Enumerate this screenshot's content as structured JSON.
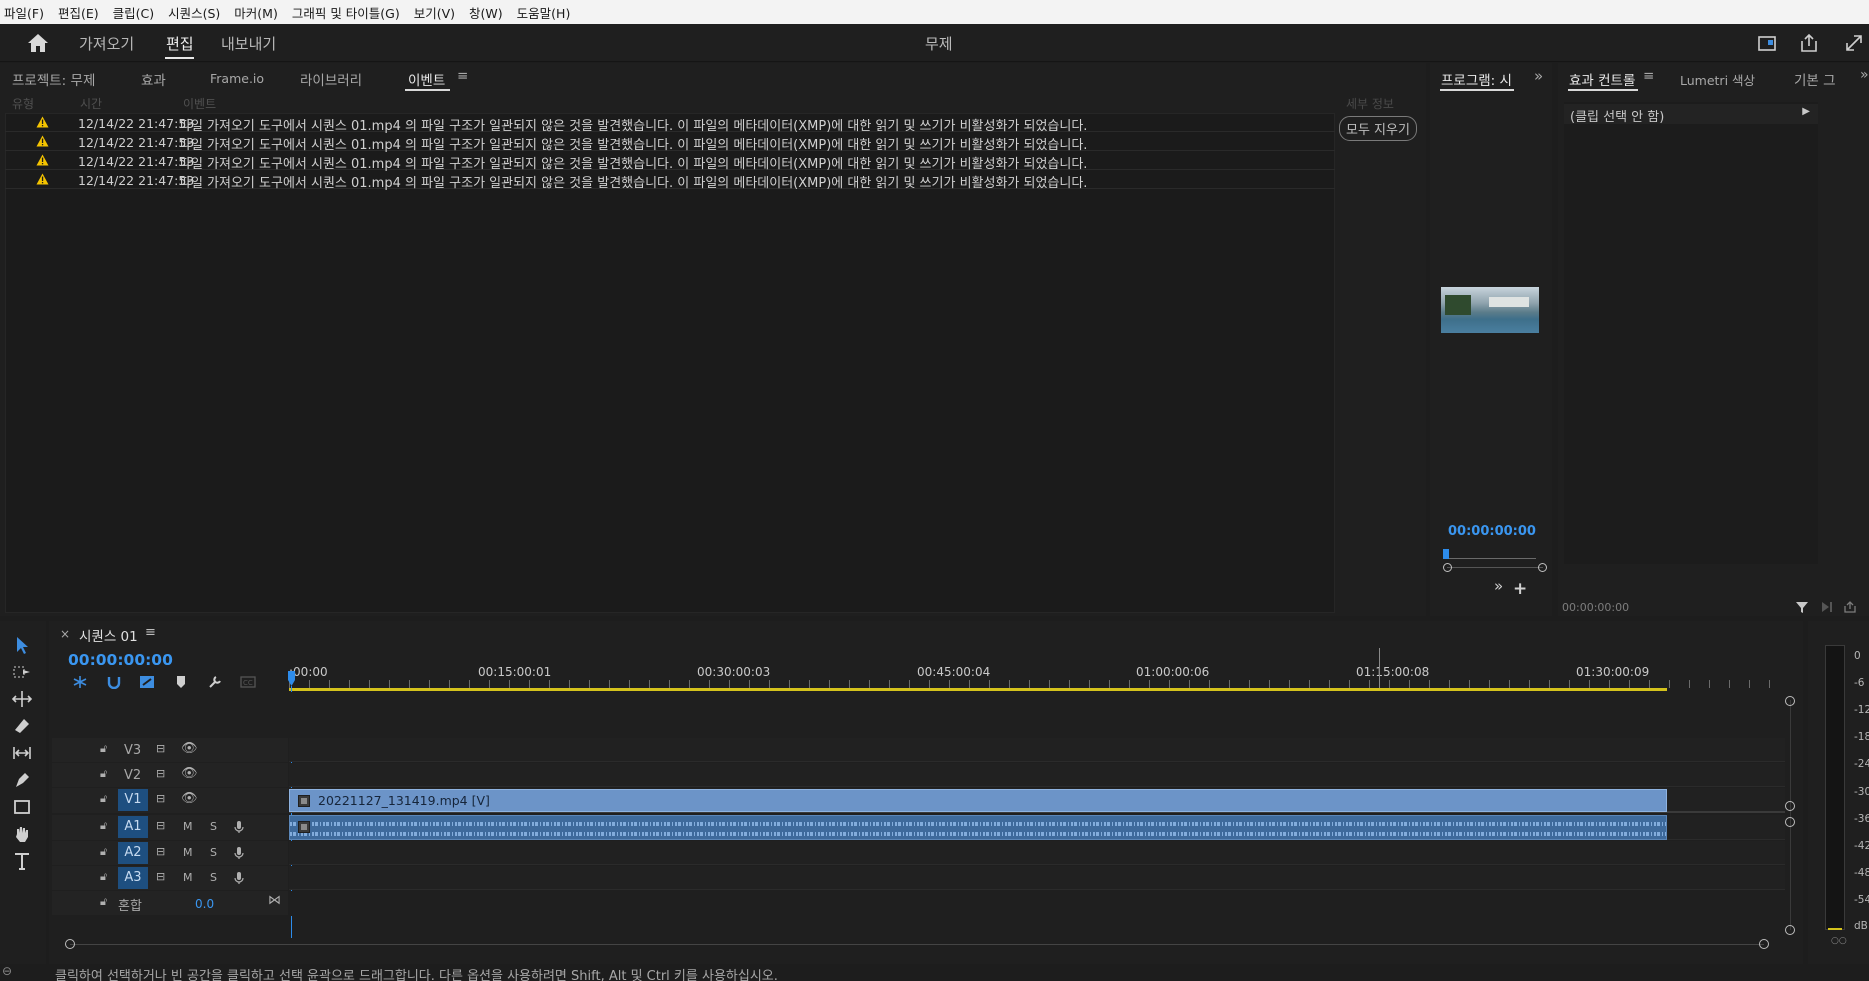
{
  "menu": [
    "파일(F)",
    "편집(E)",
    "클립(C)",
    "시퀀스(S)",
    "마커(M)",
    "그래픽 및 타이틀(G)",
    "보기(V)",
    "창(W)",
    "도움말(H)"
  ],
  "workspace": {
    "tabs": [
      "가져오기",
      "편집",
      "내보내기"
    ],
    "active_tab": "편집",
    "title": "무제"
  },
  "left_panel": {
    "tabs": [
      "프로젝트: 무제",
      "효과",
      "Frame.io",
      "라이브러리",
      "이벤트"
    ],
    "active_tab": "이벤트",
    "columns": [
      "유형",
      "시간",
      "이벤트"
    ],
    "details_label": "세부 정보",
    "clear_all_label": "모두 지우기",
    "events": [
      {
        "time": "12/14/22 21:47:53",
        "message": "파일 가져오기 도구에서 시퀀스 01.mp4 의 파일 구조가 일관되지 않은 것을 발견했습니다. 이 파일의 메타데이터(XMP)에 대한 읽기 및 쓰기가 비활성화가 되었습니다."
      },
      {
        "time": "12/14/22 21:47:53",
        "message": "파일 가져오기 도구에서 시퀀스 01.mp4 의 파일 구조가 일관되지 않은 것을 발견했습니다. 이 파일의 메타데이터(XMP)에 대한 읽기 및 쓰기가 비활성화가 되었습니다."
      },
      {
        "time": "12/14/22 21:47:53",
        "message": "파일 가져오기 도구에서 시퀀스 01.mp4 의 파일 구조가 일관되지 않은 것을 발견했습니다. 이 파일의 메타데이터(XMP)에 대한 읽기 및 쓰기가 비활성화가 되었습니다."
      },
      {
        "time": "12/14/22 21:47:53",
        "message": "파일 가져오기 도구에서 시퀀스 01.mp4 의 파일 구조가 일관되지 않은 것을 발견했습니다. 이 파일의 메타데이터(XMP)에 대한 읽기 및 쓰기가 비활성화가 되었습니다."
      }
    ]
  },
  "program_panel": {
    "tab": "프로그램: 시",
    "timecode": "00:00:00:00"
  },
  "effects_panel": {
    "tabs": [
      "효과 컨트롤",
      "Lumetri 색상",
      "기본 그"
    ],
    "active_tab": "효과 컨트롤",
    "no_clip_label": "(클립 선택 안 함)",
    "timecode": "00:00:00:00"
  },
  "timeline": {
    "sequence_name": "시퀀스 01",
    "timecode": "00:00:00:00",
    "ruler_labels": [
      ":00:00",
      "00:15:00:01",
      "00:30:00:03",
      "00:45:00:04",
      "01:00:00:06",
      "01:15:00:08",
      "01:30:00:09"
    ],
    "video_tracks": [
      "V3",
      "V2",
      "V1"
    ],
    "audio_tracks": [
      "A1",
      "A2",
      "A3"
    ],
    "source_badges": [
      "V1",
      "A1",
      "A2",
      "A3"
    ],
    "mute_label": "M",
    "solo_label": "S",
    "mix_label": "혼합",
    "mix_value": "0.0",
    "clip_name": "20221127_131419.mp4 [V]"
  },
  "audio_meter": {
    "labels": [
      "0",
      "-6",
      "-12",
      "-18",
      "-24",
      "-30",
      "-36",
      "-42",
      "-48",
      "-54",
      "dB"
    ]
  },
  "status_bar": {
    "text": "클릭하여 선택하거나 빈 공간을 클릭하고 선택 윤곽으로 드래그합니다. 다른 옵션을 사용하려면 Shift, Alt 및 Ctrl 키를 사용하십시오."
  },
  "colors": {
    "accent_blue": "#2d8ceb",
    "clip_video": "#6c94c8",
    "clip_audio": "#3e6a9c",
    "warning": "#f5c400",
    "work_area": "#d4c21c"
  }
}
